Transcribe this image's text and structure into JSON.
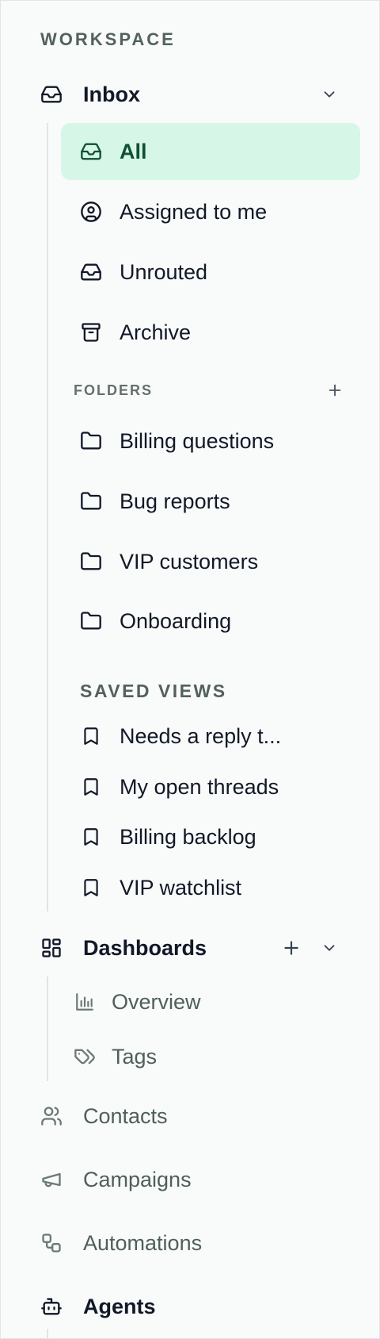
{
  "workspace": {
    "heading": "WORKSPACE"
  },
  "inbox": {
    "label": "Inbox",
    "items": [
      {
        "label": "All",
        "icon": "inbox-icon",
        "active": true
      },
      {
        "label": "Assigned to me",
        "icon": "user-circle-icon"
      },
      {
        "label": "Unrouted",
        "icon": "inbox-icon"
      },
      {
        "label": "Archive",
        "icon": "archive-icon"
      }
    ],
    "folders": {
      "heading": "FOLDERS",
      "items": [
        {
          "label": "Billing questions",
          "icon": "folder-icon"
        },
        {
          "label": "Bug reports",
          "icon": "folder-icon"
        },
        {
          "label": "VIP customers",
          "icon": "folder-icon"
        },
        {
          "label": "Onboarding",
          "icon": "folder-icon"
        }
      ]
    },
    "saved_views": {
      "heading": "SAVED VIEWS",
      "items": [
        {
          "label": "Needs a reply t...",
          "icon": "bookmark-icon"
        },
        {
          "label": "My open threads",
          "icon": "bookmark-icon"
        },
        {
          "label": "Billing backlog",
          "icon": "bookmark-icon"
        },
        {
          "label": "VIP watchlist",
          "icon": "bookmark-icon"
        }
      ]
    }
  },
  "dashboards": {
    "label": "Dashboards",
    "items": [
      {
        "label": "Overview",
        "icon": "bar-chart-icon"
      },
      {
        "label": "Tags",
        "icon": "tag-icon"
      }
    ]
  },
  "nav": {
    "contacts": "Contacts",
    "campaigns": "Campaigns",
    "automations": "Automations",
    "agents": "Agents"
  },
  "colors": {
    "active_bg": "#d6f6e8",
    "active_text": "#0f5132",
    "muted_text": "#4e5f5c",
    "primary_text": "#111827"
  }
}
